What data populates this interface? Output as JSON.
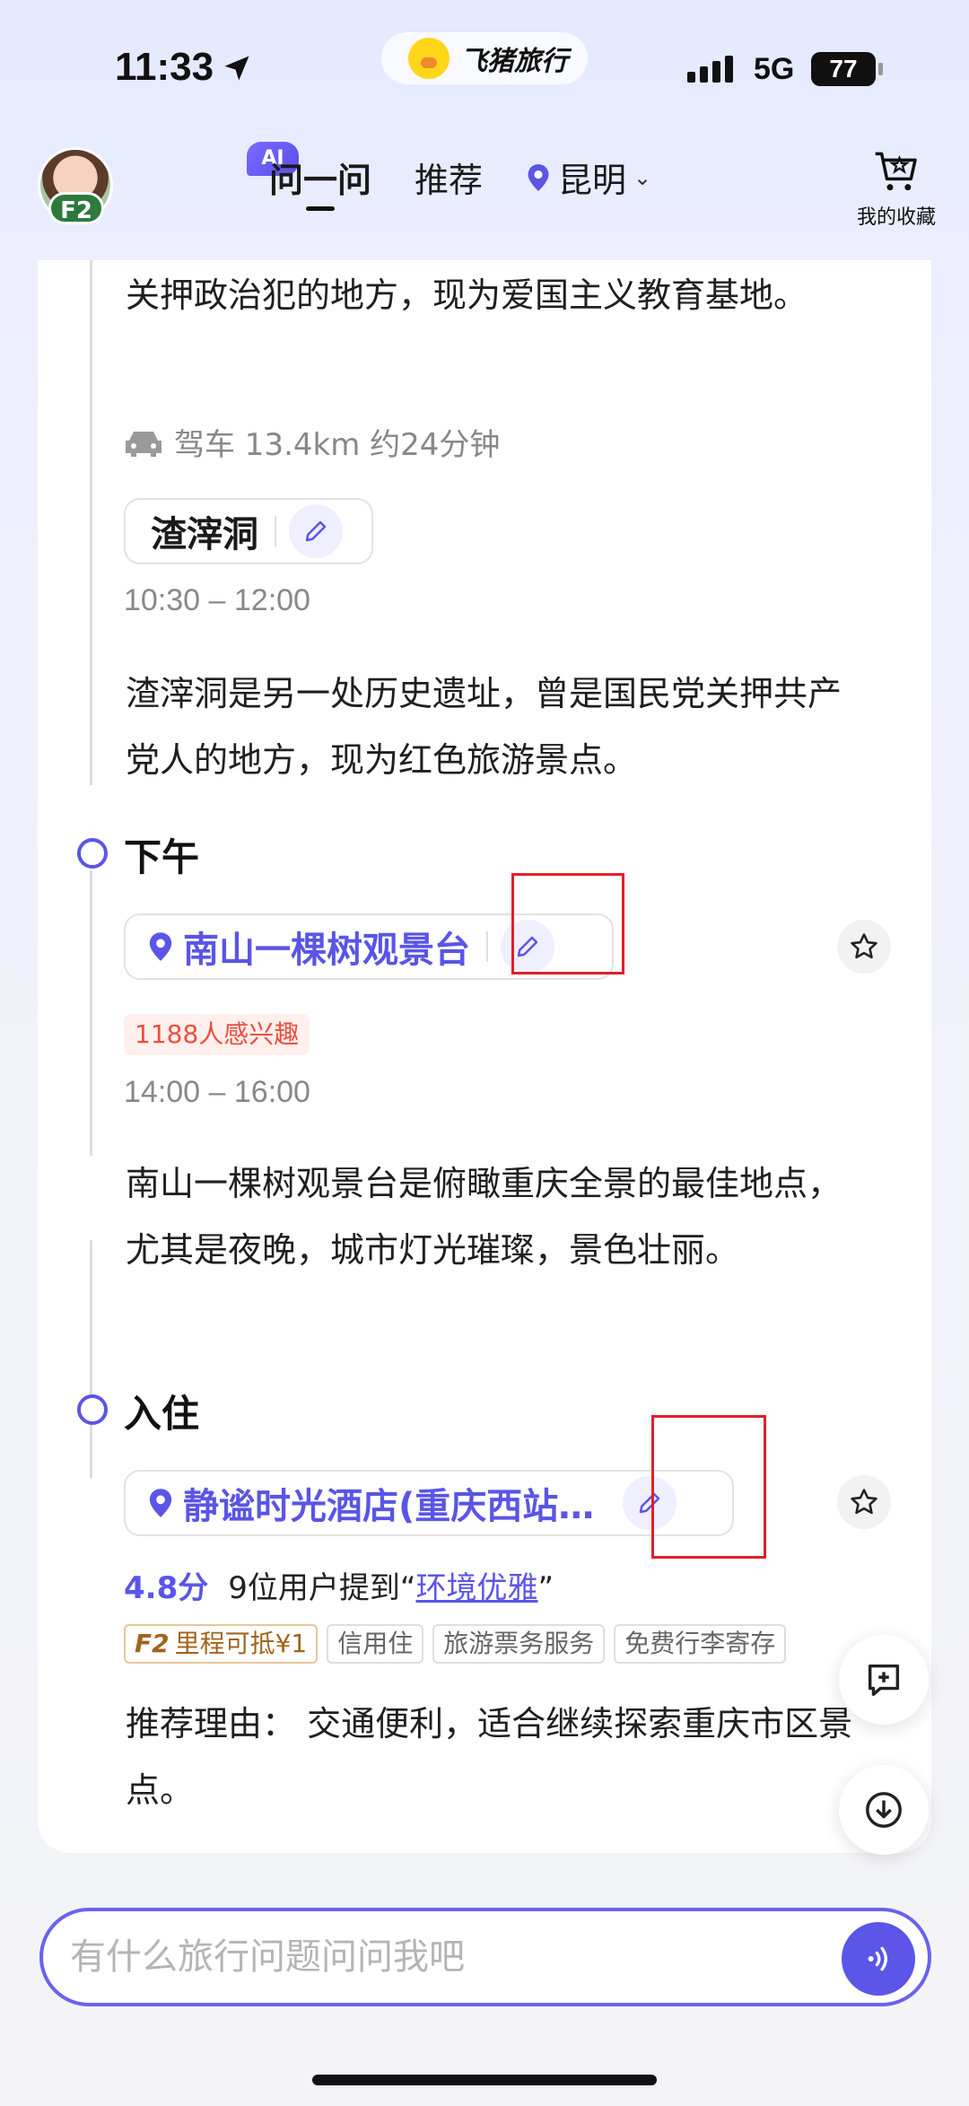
{
  "status_bar": {
    "time": "11:33",
    "app_name": "飞猪旅行",
    "network": "5G",
    "battery": "77"
  },
  "header": {
    "avatar_badge": "F2",
    "ai_badge": "AI",
    "tabs": [
      {
        "label": "问一问"
      },
      {
        "label": "推荐"
      }
    ],
    "city": "昆明",
    "favorites_label": "我的收藏"
  },
  "itinerary": {
    "intro_text": "关押政治犯的地方，现为爱国主义教育基地。",
    "drive_text": "驾车 13.4km 约24分钟",
    "morning_spot": {
      "name": "渣滓洞",
      "time": "10:30 – 12:00",
      "description": "渣滓洞是另一处历史遗址，曾是国民党关押共产党人的地方，现为红色旅游景点。"
    },
    "afternoon": {
      "title": "下午",
      "spot_name": "南山一棵树观景台",
      "interest": "1188人感兴趣",
      "time": "14:00 – 16:00",
      "description": "南山一棵树观景台是俯瞰重庆全景的最佳地点，尤其是夜晚，城市灯光璀璨，景色壮丽。"
    },
    "checkin": {
      "title": "入住",
      "hotel_name": "静谧时光酒店(重庆西站…",
      "score": "4.8分",
      "mention_prefix": "9位用户提到“",
      "mention_highlight": "环境优雅",
      "mention_suffix": "”",
      "tags": [
        "F2",
        "里程可抵¥1",
        "信用住",
        "旅游票务服务",
        "免费行李寄存"
      ],
      "reason": "推荐理由：  交通便利，适合继续探索重庆市区景点。"
    }
  },
  "input": {
    "placeholder": "有什么旅行问题问问我吧"
  },
  "colors": {
    "accent": "#5b55e8",
    "interest_red": "#ef4d3e",
    "highlight_box": "#e0202a"
  }
}
